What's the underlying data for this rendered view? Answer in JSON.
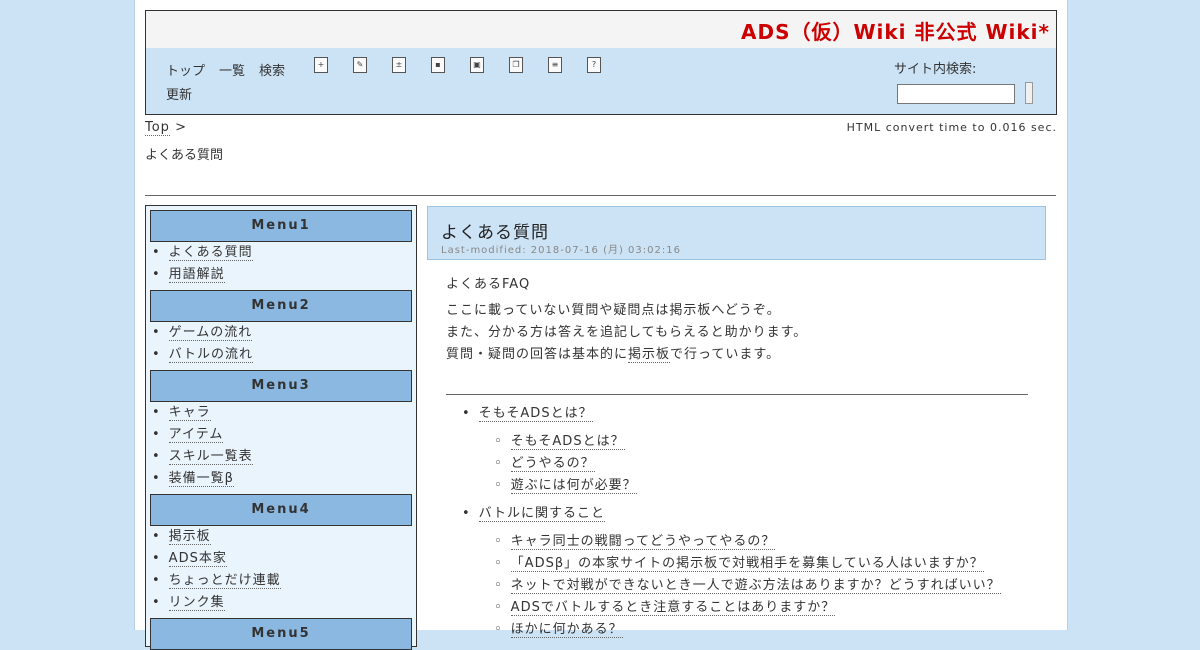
{
  "header": {
    "title": "ADS（仮）Wiki 非公式 Wiki*"
  },
  "toolbar": {
    "nav": [
      "トップ",
      "一覧",
      "検索",
      "更新"
    ],
    "icons": [
      "new-page-icon",
      "edit-icon",
      "diff-icon",
      "backup-icon",
      "freeze-icon",
      "copy-icon",
      "list-icon",
      "help-icon"
    ],
    "search_label": "サイト内検索:"
  },
  "breadcrumb": {
    "top": "Top",
    "separator": ">"
  },
  "convert_time": "HTML convert time to 0.016 sec.",
  "page_subtitle": "よくある質問",
  "sidebar": {
    "menus": [
      {
        "title": "Menu1",
        "items": [
          "よくある質問",
          "用語解説"
        ]
      },
      {
        "title": "Menu2",
        "items": [
          "ゲームの流れ",
          "バトルの流れ"
        ]
      },
      {
        "title": "Menu3",
        "items": [
          "キャラ",
          "アイテム",
          "スキル一覧表",
          "装備一覧β"
        ]
      },
      {
        "title": "Menu4",
        "items": [
          "掲示板",
          "ADS本家",
          "ちょっとだけ連載",
          "リンク集"
        ]
      },
      {
        "title": "Menu5",
        "items": []
      }
    ]
  },
  "content": {
    "title": "よくある質問",
    "last_modified": "Last-modified: 2018-07-16 (月) 03:02:16",
    "intro": {
      "lead": "よくあるFAQ",
      "lines": [
        "ここに載っていない質問や疑問点は掲示板へどうぞ。",
        "また、分かる方は答えを追記してもらえると助かります。"
      ],
      "line3_before": "質問・疑問の回答は基本的に",
      "line3_link": "掲示板",
      "line3_after": "で行っています。"
    },
    "toc": [
      {
        "label": "そもそADSとは？",
        "children": [
          "そもそADSとは？",
          "どうやるの？",
          "遊ぶには何が必要？"
        ]
      },
      {
        "label": "バトルに関すること",
        "children": [
          "キャラ同士の戦闘ってどうやってやるの？",
          "「ADSβ」の本家サイトの掲示板で対戦相手を募集している人はいますか？",
          "ネットで対戦ができないとき一人で遊ぶ方法はありますか？どうすればいい？",
          "ADSでバトルするとき注意することはありますか？",
          "ほかに何かある？"
        ]
      }
    ]
  }
}
